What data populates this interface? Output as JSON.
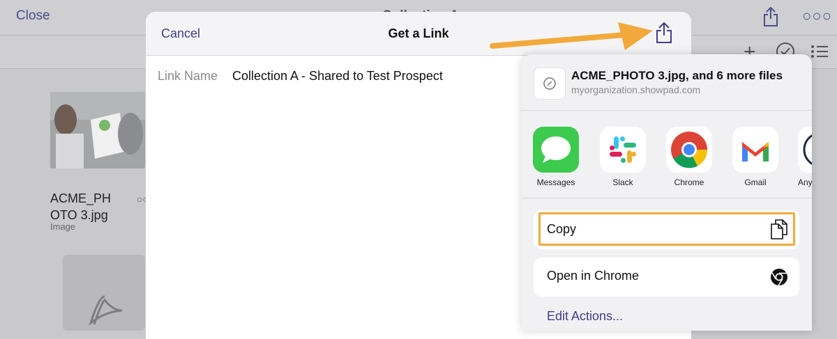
{
  "background": {
    "close_label": "Close",
    "title": "Collection A",
    "file": {
      "name_line1": "ACME_PH",
      "name_line2": "OTO 3.jpg",
      "type": "Image"
    }
  },
  "dialog": {
    "cancel_label": "Cancel",
    "title": "Get a Link",
    "link_name_label": "Link Name",
    "link_name_value": "Collection A - Shared to Test Prospect"
  },
  "share_sheet": {
    "title": "ACME_PHOTO 3.jpg, and 6 more files",
    "subtitle": "myorganization.showpad.com",
    "apps": [
      {
        "label": "Messages",
        "icon": "messages-icon"
      },
      {
        "label": "Slack",
        "icon": "slack-icon"
      },
      {
        "label": "Chrome",
        "icon": "chrome-icon"
      },
      {
        "label": "Gmail",
        "icon": "gmail-icon"
      },
      {
        "label": "Any",
        "icon": "any-app-icon"
      }
    ],
    "actions": {
      "copy": "Copy",
      "open_in_chrome": "Open in Chrome",
      "edit_actions": "Edit Actions..."
    }
  },
  "colors": {
    "accent": "#3f3f88",
    "highlight": "#f2a93b",
    "arrow": "#f2a93b"
  }
}
